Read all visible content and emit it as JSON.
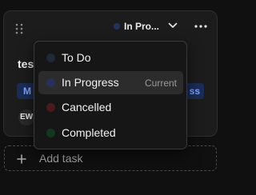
{
  "card": {
    "status_label": "In Pro...",
    "status_color": "#25325b",
    "title": "tes",
    "tag_left": "M",
    "tag_right": "ss",
    "avatar_initials": "EW",
    "icons": {
      "drag": "drag-handle-icon",
      "chevron": "chevron-down-icon",
      "more": "more-horizontal-icon"
    }
  },
  "add_task": {
    "label": "Add task",
    "icon": "plus-icon"
  },
  "dropdown": {
    "items": [
      {
        "label": "To Do",
        "color": "#1f2937",
        "badge": ""
      },
      {
        "label": "In Progress",
        "color": "#25325b",
        "badge": "Current",
        "selected": true
      },
      {
        "label": "Cancelled",
        "color": "#4a1a1a",
        "badge": ""
      },
      {
        "label": "Completed",
        "color": "#17361f",
        "badge": ""
      }
    ]
  }
}
